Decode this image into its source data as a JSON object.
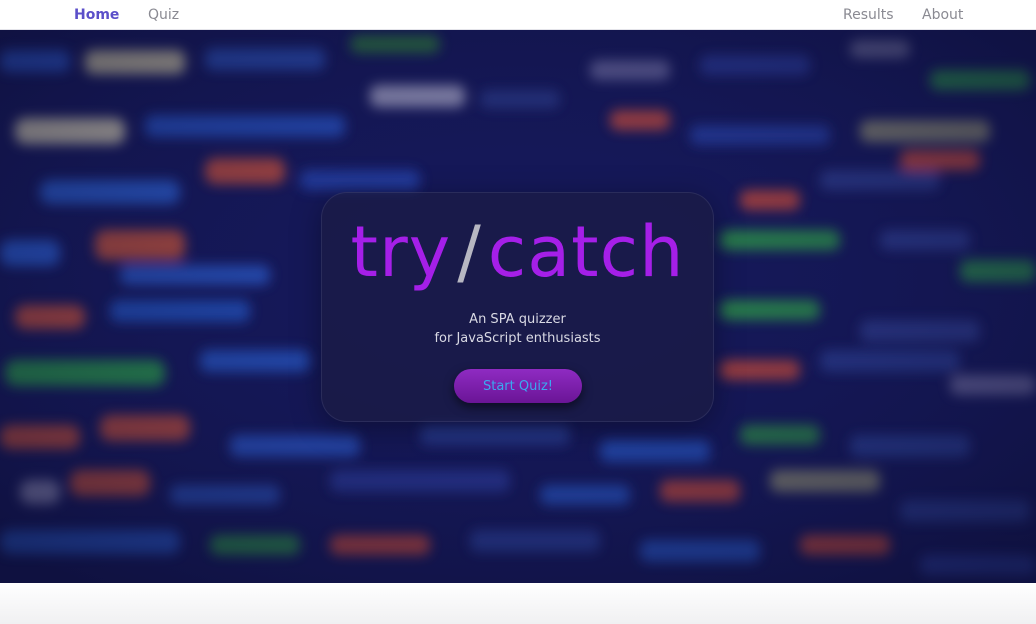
{
  "nav": {
    "left": [
      {
        "label": "Home",
        "active": true
      },
      {
        "label": "Quiz",
        "active": false
      }
    ],
    "right": [
      {
        "label": "Results"
      },
      {
        "label": "About"
      }
    ]
  },
  "hero": {
    "logo_left": "try",
    "logo_slash": "/",
    "logo_right": "catch",
    "subtitle_line1": "An SPA quizzer",
    "subtitle_line2": "for JavaScript enthusiasts",
    "start_button_label": "Start Quiz!"
  },
  "colors": {
    "accent": "#a51fe8",
    "nav_active": "#5b4fc9",
    "button_text": "#3aa9f0",
    "hero_bg": "#121446"
  }
}
